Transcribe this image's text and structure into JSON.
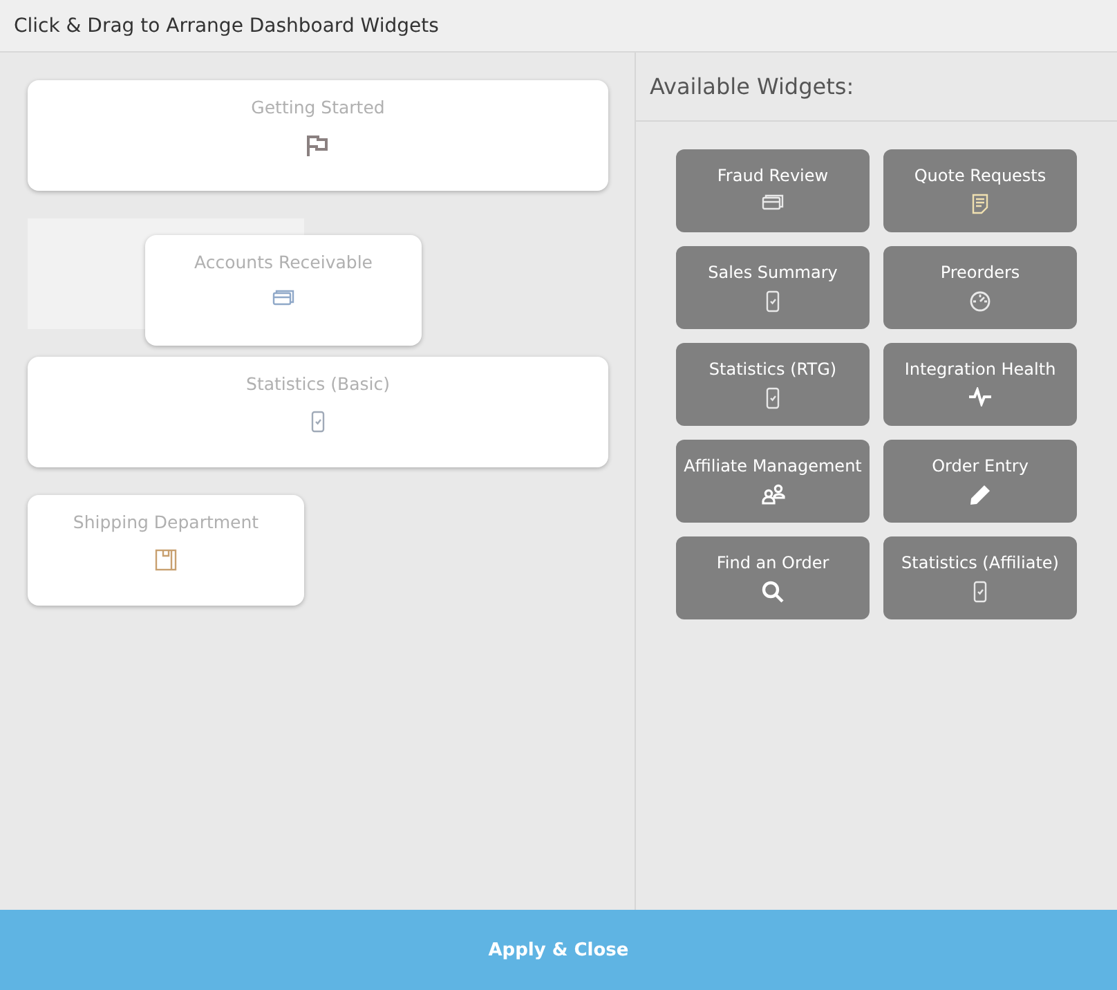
{
  "header": {
    "title": "Click & Drag to Arrange Dashboard Widgets"
  },
  "dashboard": {
    "widgets": [
      {
        "label": "Getting Started",
        "kind": "flag",
        "wide": true,
        "dragging": false
      },
      {
        "label": "Accounts Receivable",
        "kind": "cards",
        "wide": false,
        "dragging": true
      },
      {
        "label": "Statistics (Basic)",
        "kind": "phone",
        "wide": true,
        "dragging": false
      },
      {
        "label": "Shipping Department",
        "kind": "box",
        "wide": false,
        "dragging": false
      }
    ]
  },
  "available": {
    "title": "Available Widgets:",
    "widgets": [
      {
        "label": "Fraud Review",
        "kind": "cards"
      },
      {
        "label": "Quote Requests",
        "kind": "document"
      },
      {
        "label": "Sales Summary",
        "kind": "phone"
      },
      {
        "label": "Preorders",
        "kind": "gauge"
      },
      {
        "label": "Statistics (RTG)",
        "kind": "phone"
      },
      {
        "label": "Integration Health",
        "kind": "pulse"
      },
      {
        "label": "Affiliate Management",
        "kind": "people"
      },
      {
        "label": "Order Entry",
        "kind": "pencil"
      },
      {
        "label": "Find an Order",
        "kind": "search"
      },
      {
        "label": "Statistics (Affiliate)",
        "kind": "phone"
      }
    ]
  },
  "footer": {
    "button": "Apply & Close"
  }
}
